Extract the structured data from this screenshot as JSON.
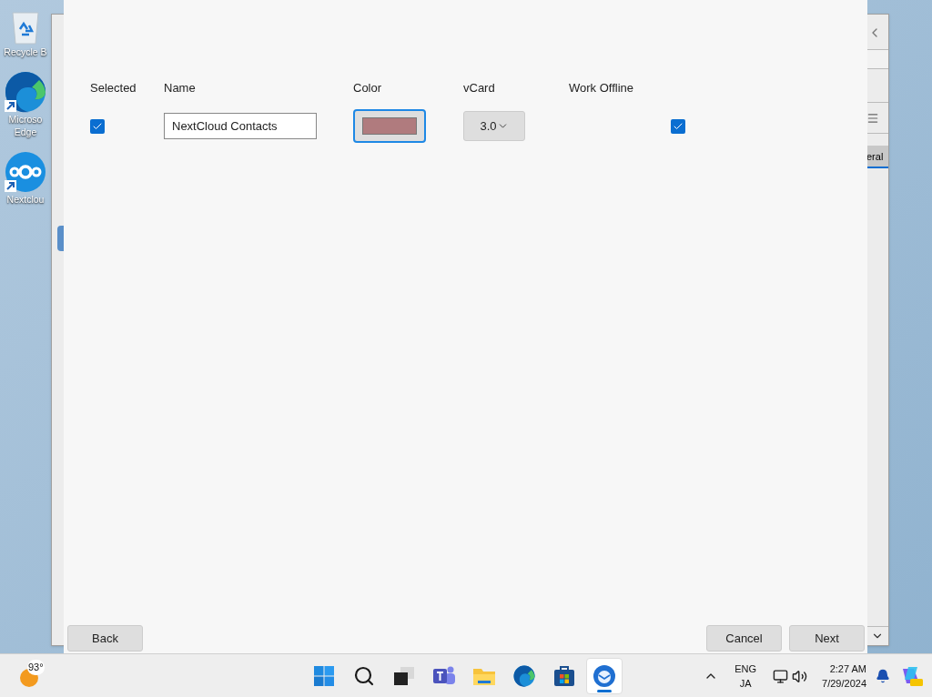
{
  "desktop_icons": [
    {
      "kind": "recycle",
      "label": "Recycle B"
    },
    {
      "kind": "edge",
      "label": "Microso Edge"
    },
    {
      "kind": "nextcloud",
      "label": "Nextclou"
    }
  ],
  "background_window": {
    "tab": "eral"
  },
  "dialog": {
    "columns": [
      "Selected",
      "Name",
      "Color",
      "vCard",
      "Work Offline"
    ],
    "row": {
      "selected": true,
      "name": "NextCloud Contacts",
      "color": "#b07b7e",
      "vcard": "3.0",
      "work_offline": true
    },
    "buttons_left": [
      "Back"
    ],
    "buttons_right": [
      "Cancel",
      "Next"
    ]
  },
  "taskbar": {
    "weather": "93°",
    "apps": [
      {
        "kind": "start",
        "selected": false
      },
      {
        "kind": "search",
        "selected": false
      },
      {
        "kind": "taskview",
        "selected": false
      },
      {
        "kind": "teams",
        "selected": false
      },
      {
        "kind": "files",
        "selected": false
      },
      {
        "kind": "edge",
        "selected": false
      },
      {
        "kind": "store",
        "selected": false
      },
      {
        "kind": "mail",
        "selected": true
      }
    ],
    "language": "ENG",
    "ime": "JA",
    "time": "2:27 AM",
    "date": "7/29/2024"
  }
}
